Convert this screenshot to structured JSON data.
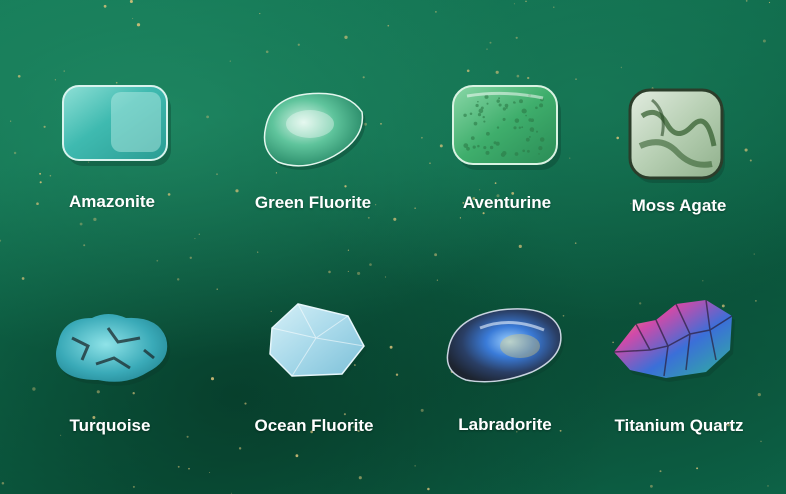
{
  "stones": [
    {
      "name": "Amazonite",
      "icon": "amazonite-stone-icon"
    },
    {
      "name": "Green Fluorite",
      "icon": "green-fluorite-stone-icon"
    },
    {
      "name": "Aventurine",
      "icon": "aventurine-stone-icon"
    },
    {
      "name": "Moss Agate",
      "icon": "moss-agate-stone-icon"
    },
    {
      "name": "Turquoise",
      "icon": "turquoise-stone-icon"
    },
    {
      "name": "Ocean Fluorite",
      "icon": "ocean-fluorite-stone-icon"
    },
    {
      "name": "Labradorite",
      "icon": "labradorite-stone-icon"
    },
    {
      "name": "Titanium Quartz",
      "icon": "titanium-quartz-stone-icon"
    }
  ],
  "colors": {
    "background": "#0f6a4b",
    "label": "#ffffff",
    "sparkle": "#d8c27a"
  }
}
